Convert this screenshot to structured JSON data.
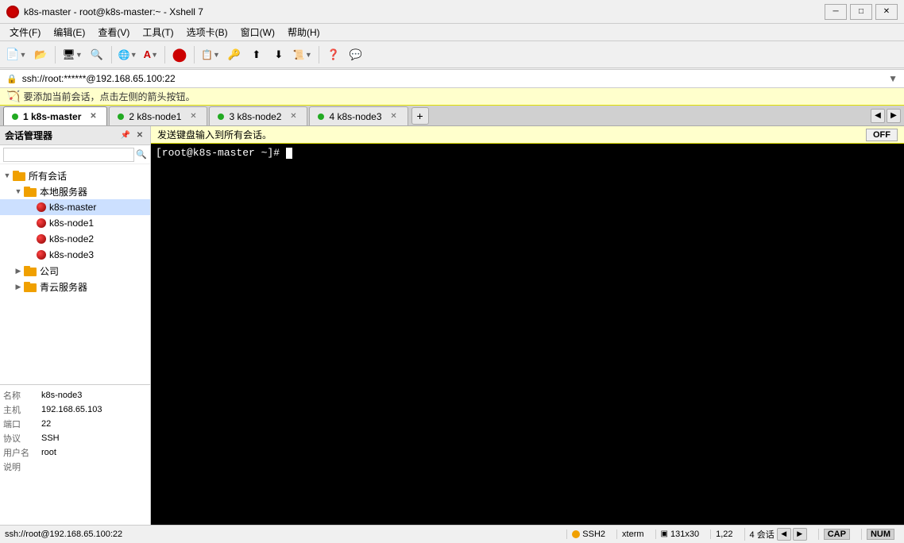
{
  "titleBar": {
    "title": "k8s-master - root@k8s-master:~ - Xshell 7",
    "minimize": "─",
    "maximize": "□",
    "close": "✕"
  },
  "menuBar": {
    "items": [
      "文件(F)",
      "编辑(E)",
      "查看(V)",
      "工具(T)",
      "选项卡(B)",
      "窗口(W)",
      "帮助(H)"
    ]
  },
  "addressBar": {
    "url": "ssh://root:******@192.168.65.100:22"
  },
  "noticeBar": {
    "text": "要添加当前会话，点击左侧的箭头按钮。"
  },
  "tabs": [
    {
      "id": 1,
      "label": "1 k8s-master",
      "dotColor": "#22aa22",
      "active": true
    },
    {
      "id": 2,
      "label": "2 k8s-node1",
      "dotColor": "#22aa22",
      "active": false
    },
    {
      "id": 3,
      "label": "3 k8s-node2",
      "dotColor": "#22aa22",
      "active": false
    },
    {
      "id": 4,
      "label": "4 k8s-node3",
      "dotColor": "#22aa22",
      "active": false
    }
  ],
  "broadcastBar": {
    "text": "发送键盘输入到所有会话。",
    "toggleLabel": "OFF"
  },
  "sidebar": {
    "title": "会话管理器",
    "searchPlaceholder": "",
    "tree": {
      "rootLabel": "所有会话",
      "children": [
        {
          "label": "本地服务器",
          "expanded": true,
          "children": [
            {
              "label": "k8s-master"
            },
            {
              "label": "k8s-node1"
            },
            {
              "label": "k8s-node2"
            },
            {
              "label": "k8s-node3"
            }
          ]
        },
        {
          "label": "公司",
          "expanded": false
        },
        {
          "label": "青云服务器",
          "expanded": false
        }
      ]
    }
  },
  "infoPanel": {
    "rows": [
      {
        "label": "名称",
        "value": "k8s-node3"
      },
      {
        "label": "主机",
        "value": "192.168.65.103"
      },
      {
        "label": "端口",
        "value": "22"
      },
      {
        "label": "协议",
        "value": "SSH"
      },
      {
        "label": "用户名",
        "value": "root"
      },
      {
        "label": "说明",
        "value": ""
      }
    ]
  },
  "terminal": {
    "prompt": "[root@k8s-master ~]# "
  },
  "statusBar": {
    "leftText": "ssh://root@192.168.65.100:22",
    "protocol": "SSH2",
    "encoding": "xterm",
    "dimensions": "131x30",
    "cursor": "1,22",
    "sessions": "4 会话",
    "cap": "CAP",
    "num": "NUM"
  }
}
